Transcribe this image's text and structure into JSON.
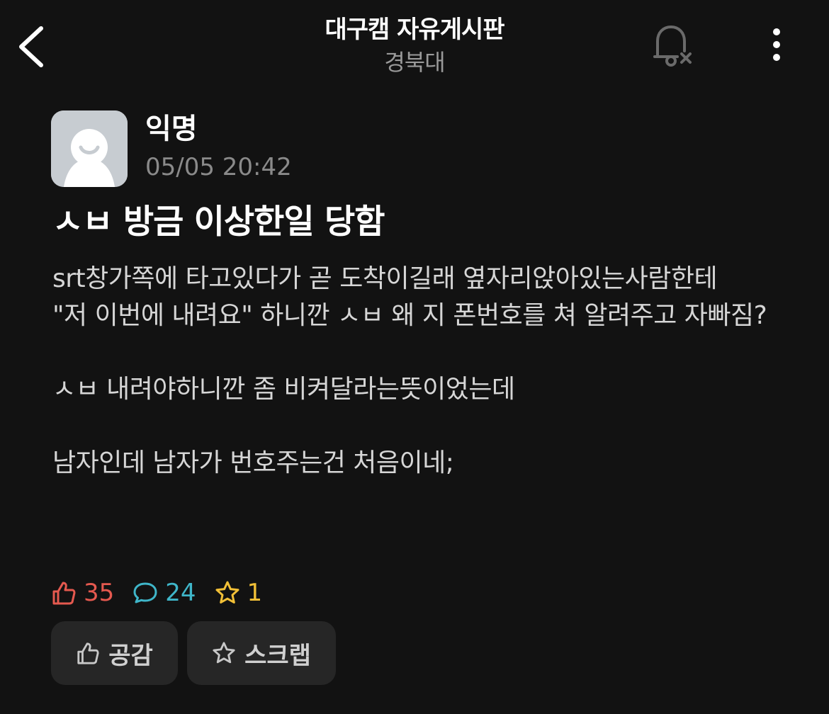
{
  "header": {
    "title": "대구캠 자유게시판",
    "subtitle": "경북대",
    "back_icon": "chevron-left-icon",
    "notification_icon": "bell-off-icon",
    "more_icon": "more-vertical-icon"
  },
  "post": {
    "author": "익명",
    "time": "05/05 20:42",
    "title": "ㅅㅂ 방금 이상한일 당함",
    "body": "srt창가쪽에 타고있다가 곧 도착이길래 옆자리앉아있는사람한테\n\"저 이번에 내려요\" 하니깐 ㅅㅂ 왜 지 폰번호를 쳐 알려주고 자빠짐?\n\nㅅㅂ 내려야하니깐 좀 비켜달라는뜻이었는데\n\n남자인데 남자가 번호주는건 처음이네;"
  },
  "stats": {
    "likes": "35",
    "comments": "24",
    "scraps": "1"
  },
  "actions": {
    "like_label": "공감",
    "scrap_label": "스크랩"
  },
  "colors": {
    "background": "#121212",
    "like": "#e5594f",
    "comment": "#3fb6c9",
    "scrap": "#f2c037",
    "button_bg": "#262626"
  }
}
